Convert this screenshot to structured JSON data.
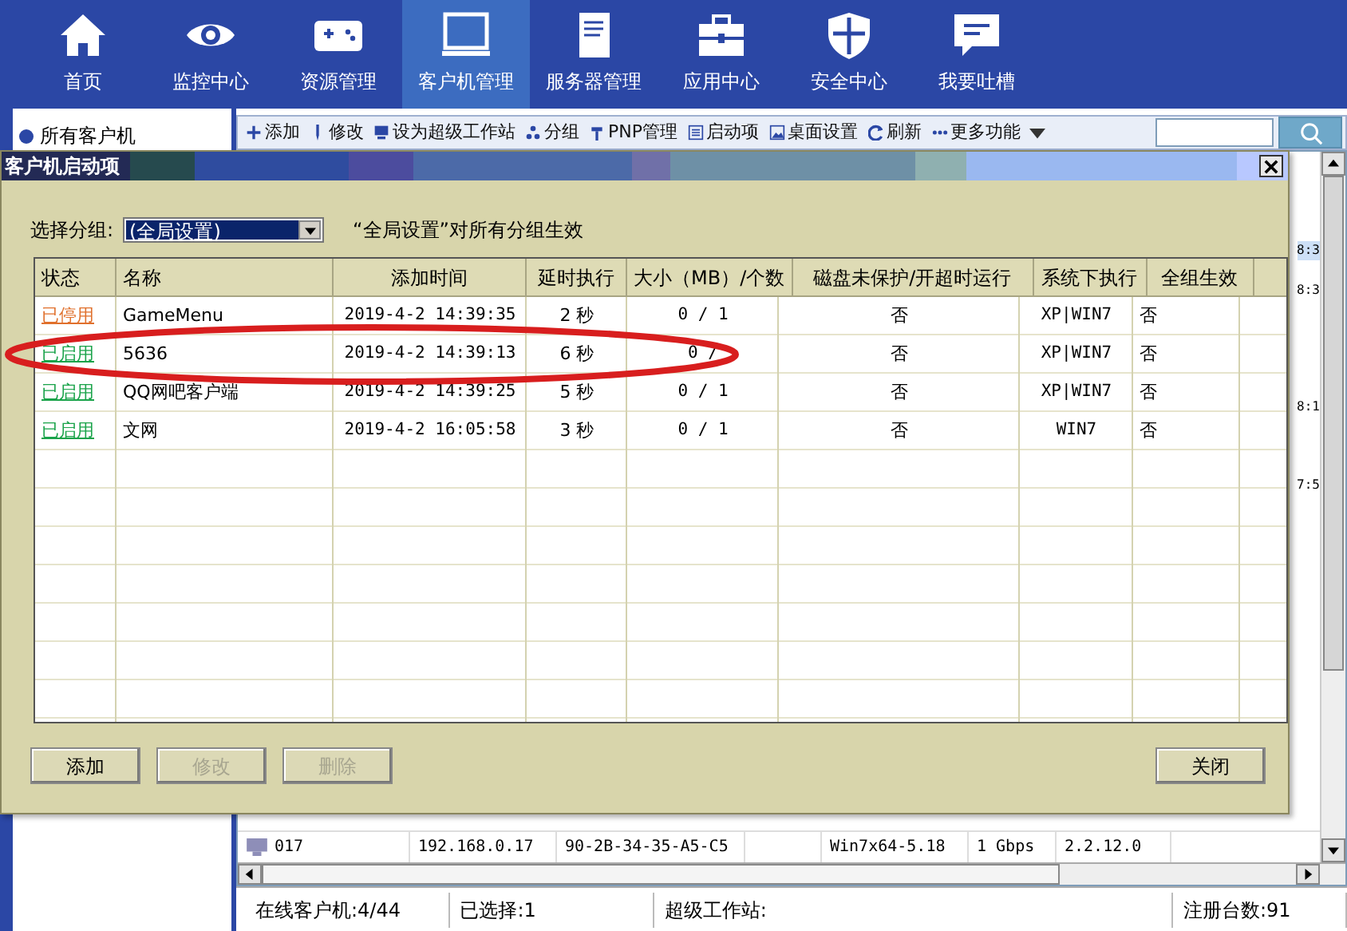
{
  "nav": [
    {
      "label": "首页",
      "selected": false
    },
    {
      "label": "监控中心",
      "selected": false
    },
    {
      "label": "资源管理",
      "selected": false
    },
    {
      "label": "客户机管理",
      "selected": true
    },
    {
      "label": "服务器管理",
      "selected": false
    },
    {
      "label": "应用中心",
      "selected": false
    },
    {
      "label": "安全中心",
      "selected": false
    },
    {
      "label": "我要吐槽",
      "selected": false
    }
  ],
  "sidebar": {
    "items": [
      {
        "label": "所有客户机"
      }
    ]
  },
  "toolbar": {
    "items": [
      {
        "label": "添加"
      },
      {
        "label": "修改"
      },
      {
        "label": "设为超级工作站"
      },
      {
        "label": "分组"
      },
      {
        "label": "PNP管理"
      },
      {
        "label": "启动项"
      },
      {
        "label": "桌面设置"
      },
      {
        "label": "刷新"
      },
      {
        "label": "更多功能"
      }
    ]
  },
  "client_table": {
    "fragments": [
      {
        "kind": "text",
        "text": "8:3",
        "selected": true
      },
      {
        "kind": "text",
        "text": "8:3",
        "selected": false
      },
      {
        "kind": "blank"
      },
      {
        "kind": "blank"
      },
      {
        "kind": "text",
        "text": "8:1",
        "selected": false
      },
      {
        "kind": "blank"
      },
      {
        "kind": "text",
        "text": "7:5",
        "selected": false
      }
    ],
    "rows": [
      {
        "name": "017",
        "ip": "192.168.0.17",
        "mac": "90-2B-34-35-A5-C5",
        "os": "Win7x64-5.18",
        "speed": "1 Gbps",
        "version": "2.2.12.0"
      }
    ]
  },
  "status_bar": [
    "在线客户机:4/44",
    "已选择:1",
    "超级工作站:",
    "注册台数:91"
  ],
  "dialog": {
    "title": "客户机启动项",
    "group_label": "选择分组:",
    "group_value": "(全局设置)",
    "group_note": "“全局设置”对所有分组生效",
    "columns": [
      "状态",
      "名称",
      "添加时间",
      "延时执行",
      "大小（MB）/个数",
      "磁盘未保护/开超时运行",
      "系统下执行",
      "全组生效"
    ],
    "rows": [
      {
        "status": "已停用",
        "enabled": false,
        "name": "GameMenu",
        "added": "2019-4-2 14:39:35",
        "delay": "2 秒",
        "size": "0 / 1",
        "disk": "否",
        "os": "XP|WIN7",
        "all_groups": "否",
        "circled": false
      },
      {
        "status": "已启用",
        "enabled": true,
        "name": "5636",
        "added": "2019-4-2 14:39:13",
        "delay": "6 秒",
        "size": "0 /",
        "disk": "否",
        "os": "XP|WIN7",
        "all_groups": "否",
        "circled": true
      },
      {
        "status": "已启用",
        "enabled": true,
        "name": "QQ网吧客户端",
        "added": "2019-4-2 14:39:25",
        "delay": "5 秒",
        "size": "0 / 1",
        "disk": "否",
        "os": "XP|WIN7",
        "all_groups": "否",
        "circled": false
      },
      {
        "status": "已启用",
        "enabled": true,
        "name": "文网",
        "added": "2019-4-2 16:05:58",
        "delay": "3 秒",
        "size": "0 / 1",
        "disk": "否",
        "os": "WIN7",
        "all_groups": "否",
        "circled": false
      }
    ],
    "buttons": [
      {
        "label": "添加",
        "disabled": false
      },
      {
        "label": "修改",
        "disabled": true
      },
      {
        "label": "删除",
        "disabled": true
      }
    ],
    "close_button": "关闭"
  }
}
